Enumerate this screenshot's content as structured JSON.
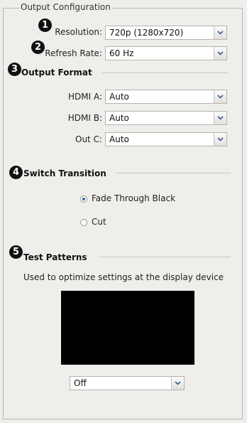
{
  "group_title": "Output Configuration",
  "callouts": [
    "1",
    "2",
    "3",
    "4",
    "5"
  ],
  "resolution": {
    "label": "Resolution:",
    "value": "720p (1280x720)"
  },
  "refresh_rate": {
    "label": "Refresh Rate:",
    "value": "60 Hz"
  },
  "output_format": {
    "title": "Output Format",
    "hdmi_a": {
      "label": "HDMI A:",
      "value": "Auto"
    },
    "hdmi_b": {
      "label": "HDMI B:",
      "value": "Auto"
    },
    "out_c": {
      "label": "Out C:",
      "value": "Auto"
    }
  },
  "switch_transition": {
    "title": "Switch Transition",
    "options": [
      {
        "label": "Fade Through Black",
        "selected": true
      },
      {
        "label": "Cut",
        "selected": false
      }
    ]
  },
  "test_patterns": {
    "title": "Test Patterns",
    "description": "Used to optimize settings at the display device",
    "value": "Off"
  }
}
